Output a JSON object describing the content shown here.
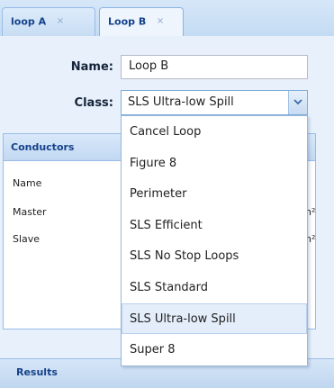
{
  "tabs": [
    {
      "label": "loop A",
      "close": "×",
      "active": false
    },
    {
      "label": "Loop B",
      "close": "×",
      "active": true
    }
  ],
  "form": {
    "name_label": "Name:",
    "name_value": "Loop B",
    "class_label": "Class:",
    "class_value": "SLS Ultra-low Spill"
  },
  "conductors": {
    "title": "Conductors",
    "rows": [
      "Name",
      "Master",
      "Slave"
    ],
    "unit_partial": "n²"
  },
  "dropdown": {
    "options": [
      "Cancel Loop",
      "Figure 8",
      "Perimeter",
      "SLS Efficient",
      "SLS No Stop Loops",
      "SLS Standard",
      "SLS Ultra-low Spill",
      "Super 8"
    ],
    "selected_index": 6
  },
  "results": {
    "title": "Results"
  },
  "colors": {
    "accent": "#15428b",
    "border": "#99bbe8",
    "selected_bg": "#e4eefa"
  },
  "icons": {
    "tab_close": "close-icon",
    "combo_trigger": "chevron-down-icon"
  }
}
